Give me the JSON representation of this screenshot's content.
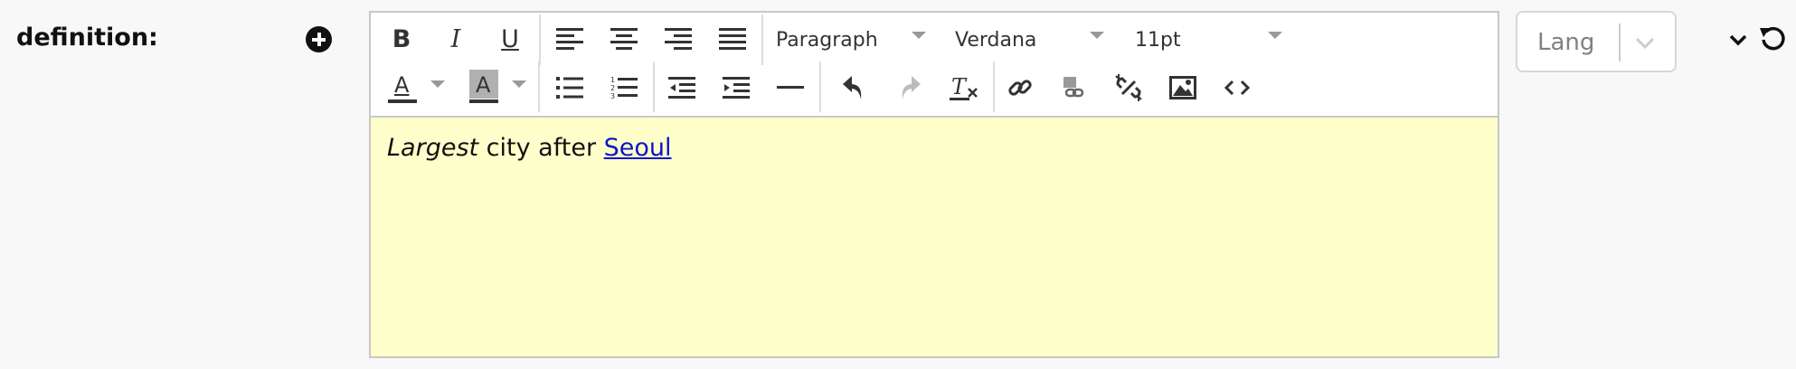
{
  "field": {
    "label": "definition:",
    "add_button_icon": "plus-circle-icon"
  },
  "toolbar": {
    "bold_label": "B",
    "italic_label": "I",
    "underline_label": "U",
    "block_format": "Paragraph",
    "font_family": "Verdana",
    "font_size": "11pt",
    "text_color_label": "A",
    "background_color_label": "A",
    "icons": [
      "bold-icon",
      "italic-icon",
      "underline-icon",
      "align-left-icon",
      "align-center-icon",
      "align-right-icon",
      "align-justify-icon",
      "text-color-icon",
      "background-color-icon",
      "bullet-list-icon",
      "numbered-list-icon",
      "outdent-icon",
      "indent-icon",
      "horizontal-rule-icon",
      "undo-icon",
      "redo-icon",
      "clear-formatting-icon",
      "link-icon",
      "anchor-link-icon",
      "unlink-icon",
      "image-icon",
      "code-icon"
    ]
  },
  "content": {
    "italic_text": "Largest",
    "plain_text": " city after ",
    "link_text": "Seoul",
    "background_color": "#ffffcc",
    "link_color": "#0b15c8"
  },
  "lang": {
    "placeholder": "Lang"
  },
  "actions": {
    "collapse_icon": "chevron-down-icon",
    "reset_icon": "reset-icon"
  }
}
